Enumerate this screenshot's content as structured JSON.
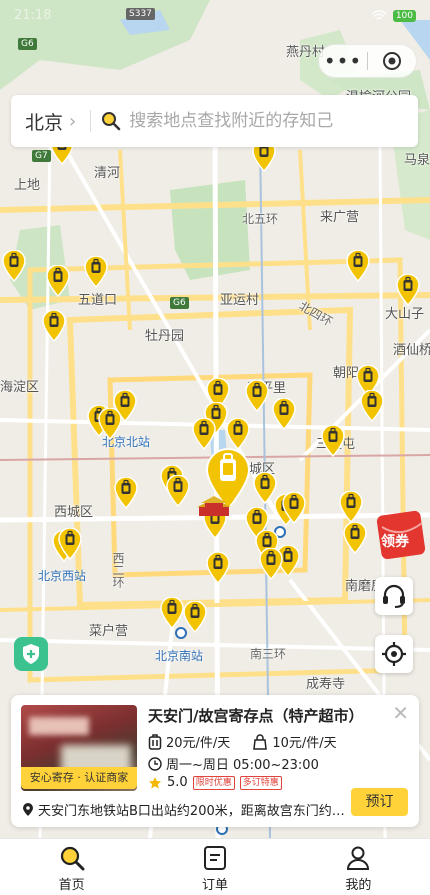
{
  "status": {
    "time": "21:18",
    "battery": "100"
  },
  "capsule": {
    "more_icon": "more-dots-icon",
    "close_icon": "target-close-icon"
  },
  "search": {
    "city": "北京",
    "placeholder": "搜索地点查找附近的存知己"
  },
  "map": {
    "labels": [
      {
        "text": "燕丹村"
      },
      {
        "text": "温榆河公园"
      },
      {
        "text": "马泉"
      },
      {
        "text": "上地"
      },
      {
        "text": "清河"
      },
      {
        "text": "北五环"
      },
      {
        "text": "来广营"
      },
      {
        "text": "五道口"
      },
      {
        "text": "亚运村"
      },
      {
        "text": "大山子"
      },
      {
        "text": "北四环"
      },
      {
        "text": "牡丹园"
      },
      {
        "text": "酒仙桥"
      },
      {
        "text": "朝阳"
      },
      {
        "text": "海淀区"
      },
      {
        "text": "和平里"
      },
      {
        "text": "北京北站"
      },
      {
        "text": "三里屯"
      },
      {
        "text": "东城区"
      },
      {
        "text": "西城区"
      },
      {
        "text": "北京西站"
      },
      {
        "text": "西二环"
      },
      {
        "text": "南磨房"
      },
      {
        "text": "菜户营"
      },
      {
        "text": "北京南站"
      },
      {
        "text": "南三环"
      },
      {
        "text": "成寿寺"
      }
    ],
    "road_badges": [
      "G6",
      "S337",
      "G7",
      "G6"
    ]
  },
  "floating": {
    "coupon_label": "领券"
  },
  "card": {
    "title": "天安门/故宫寄存点（特产超市）",
    "photo_tag": "安心寄存 · 认证商家",
    "price_luggage": "20元/件/天",
    "price_bag": "10元/件/天",
    "hours": "周一~周日 05:00~23:00",
    "rating": "5.0",
    "tags": [
      "限时优惠",
      "多订特惠"
    ],
    "address": "天安门东地铁站B口出站约200米，距离故宫东门约…",
    "book_label": "预订"
  },
  "tabs": [
    {
      "label": "首页",
      "icon": "search-icon"
    },
    {
      "label": "订单",
      "icon": "order-list-icon"
    },
    {
      "label": "我的",
      "icon": "user-icon"
    }
  ],
  "colors": {
    "accent": "#ffd23a",
    "pin": "#f2c300",
    "green": "#3cc28f"
  }
}
